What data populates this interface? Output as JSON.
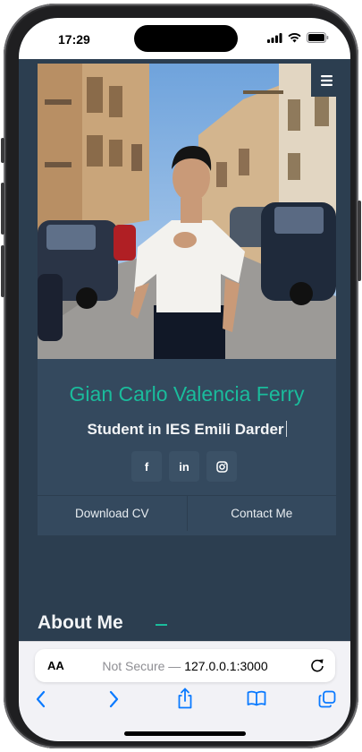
{
  "status_bar": {
    "time": "17:29",
    "icons": [
      "signal-icon",
      "wifi-icon",
      "battery-icon"
    ]
  },
  "nav": {
    "menu_icon": "menu-icon"
  },
  "hero": {
    "name": "Gian Carlo Valencia Ferry",
    "role": "Student in IES Emili Darder",
    "socials": [
      {
        "label": "f",
        "icon": "facebook-icon"
      },
      {
        "label": "in",
        "icon": "linkedin-icon"
      },
      {
        "label": "",
        "icon": "instagram-icon"
      }
    ],
    "buttons": {
      "download_cv": "Download CV",
      "contact_me": "Contact Me"
    }
  },
  "section": {
    "about_title": "About Me"
  },
  "browser": {
    "aa_label": "AA",
    "not_secure": "Not Secure —",
    "host": "127.0.0.1:3000",
    "toolbar_icons": [
      "back-icon",
      "forward-icon",
      "share-icon",
      "bookmarks-icon",
      "tabs-icon"
    ]
  },
  "colors": {
    "accent": "#1abc9c",
    "page_bg": "#2c3e50",
    "card_bg": "#34495e",
    "ios_blue": "#0a7aff"
  }
}
